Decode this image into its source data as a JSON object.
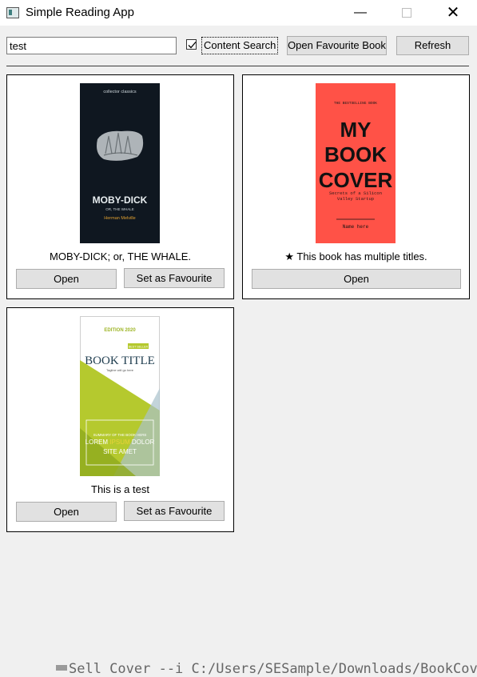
{
  "window": {
    "title": "Simple Reading App",
    "minimize_glyph": "—",
    "close_glyph": "✕"
  },
  "toolbar": {
    "search_value": "test",
    "content_search_label": "Content Search",
    "content_search_checked": true,
    "open_favourite_label": "Open Favourite Book",
    "refresh_label": "Refresh"
  },
  "books": [
    {
      "title": "MOBY-DICK; or, THE WHALE.",
      "open_label": "Open",
      "favourite_label": "Set as Favourite",
      "cover": {
        "publisher_line": "collector classics",
        "main_title": "MOBY-DICK",
        "subtitle": "OR, THE WHALE",
        "author": "Herman Melville",
        "bg_color": "#0f1720"
      }
    },
    {
      "title": "This book has multiple titles.",
      "star_glyph": "★",
      "open_label": "Open",
      "cover": {
        "top_line": "THE BESTSELLING BOOK",
        "main_title": [
          "MY",
          "BOOK",
          "COVER"
        ],
        "subtitle": "Secrets of a Silicon Valley Startup",
        "author": "Name here",
        "bg_color": "#ff5247"
      }
    },
    {
      "title": "This is a test",
      "open_label": "Open",
      "favourite_label": "Set as Favourite",
      "cover": {
        "publisher_line": "EDITION 2020",
        "tag": "BEST SELLER",
        "main_title": "BOOK TITLE",
        "tagline": "Tagline will go here",
        "body_line": "SUMMARY OF THE BOOK HERE",
        "lorem": [
          "LOREM",
          "IPSUM",
          "DOLOR"
        ],
        "lorem_2": "SITE AMET",
        "accent_color": "#b5c92e"
      }
    }
  ],
  "background_text": "Sell Cover --i C:/Users/SESample/Downloads/BookCover"
}
